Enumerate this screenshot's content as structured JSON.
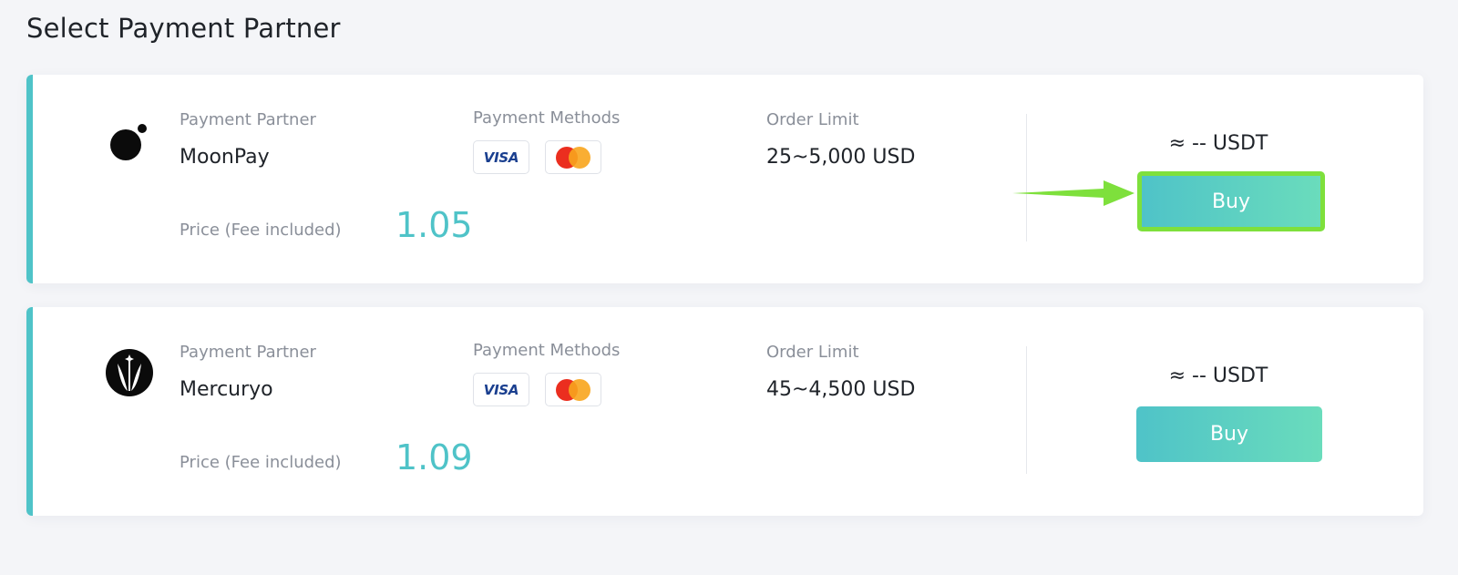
{
  "page": {
    "title": "Select Payment Partner"
  },
  "labels": {
    "partner": "Payment Partner",
    "methods": "Payment Methods",
    "limit": "Order Limit",
    "price": "Price (Fee included)"
  },
  "payment_methods": [
    {
      "name": "VISA",
      "icon": "visa-icon"
    },
    {
      "name": "Mastercard",
      "icon": "mastercard-icon"
    }
  ],
  "partners": [
    {
      "name": "MoonPay",
      "logo_icon": "moonpay-logo-icon",
      "order_limit": "25~5,000 USD",
      "price": "1.05",
      "quote": "≈ -- USDT",
      "buy_label": "Buy",
      "highlighted": true
    },
    {
      "name": "Mercuryo",
      "logo_icon": "mercuryo-logo-icon",
      "order_limit": "45~4,500 USD",
      "price": "1.09",
      "quote": "≈ -- USDT",
      "buy_label": "Buy",
      "highlighted": false
    }
  ],
  "colors": {
    "accent": "#4fc3c8",
    "accent_end": "#6adcbc",
    "highlight": "#7ee03c",
    "visa": "#1a3f8f",
    "mastercard_red": "#eb2e1f",
    "mastercard_orange": "#f8a51d"
  }
}
